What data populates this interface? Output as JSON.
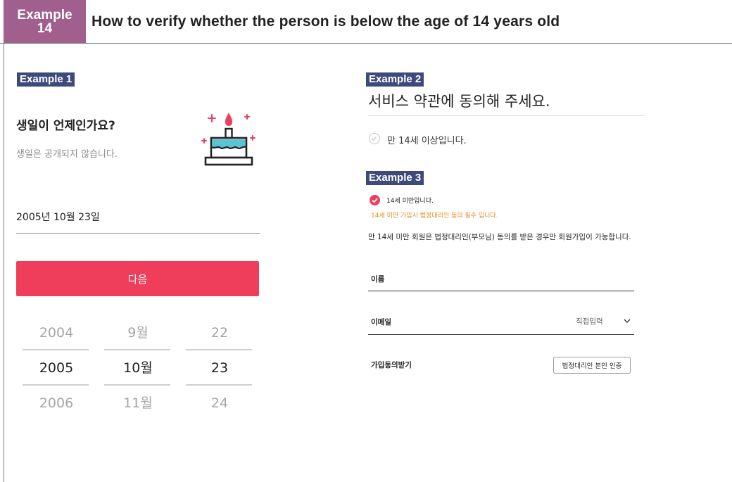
{
  "header": {
    "badge_line1": "Example",
    "badge_line2": "14",
    "title": "How to verify whether the person is below the age of 14 years old"
  },
  "example1": {
    "label": "Example 1",
    "question": "생일이 언제인가요?",
    "subtitle": "생일은 공개되지 않습니다.",
    "date_value": "2005년 10월 23일",
    "next_button": "다음",
    "picker": {
      "years": [
        "2004",
        "2005",
        "2006"
      ],
      "months": [
        "9월",
        "10월",
        "11월"
      ],
      "days": [
        "22",
        "23",
        "24"
      ]
    }
  },
  "example2": {
    "label": "Example 2",
    "title": "서비스 약관에 동의해 주세요.",
    "option_over14": "만 14세 이상입니다."
  },
  "example3": {
    "label": "Example 3",
    "option_under14": "14세 미만입니다.",
    "warning": "14세 미만 가입시 법정대리인 동의 필수 입니다.",
    "notice": "만 14세 미만 회원은 법정대리인(부모님) 동의를 받은 경우만 회원가입이 가능합니다.",
    "name_label": "이름",
    "email_label": "이메일",
    "email_select": "직접입력",
    "consent_label": "가입동의받기",
    "guardian_button": "법정대리인 본인 인증"
  },
  "colors": {
    "badge": "#a05f8c",
    "example_label": "#3f4a7c",
    "accent": "#ef3e5c",
    "warning": "#e98a1f"
  },
  "icons": [
    "birthday-cake-icon",
    "check-circle-icon",
    "chevron-down-icon"
  ]
}
